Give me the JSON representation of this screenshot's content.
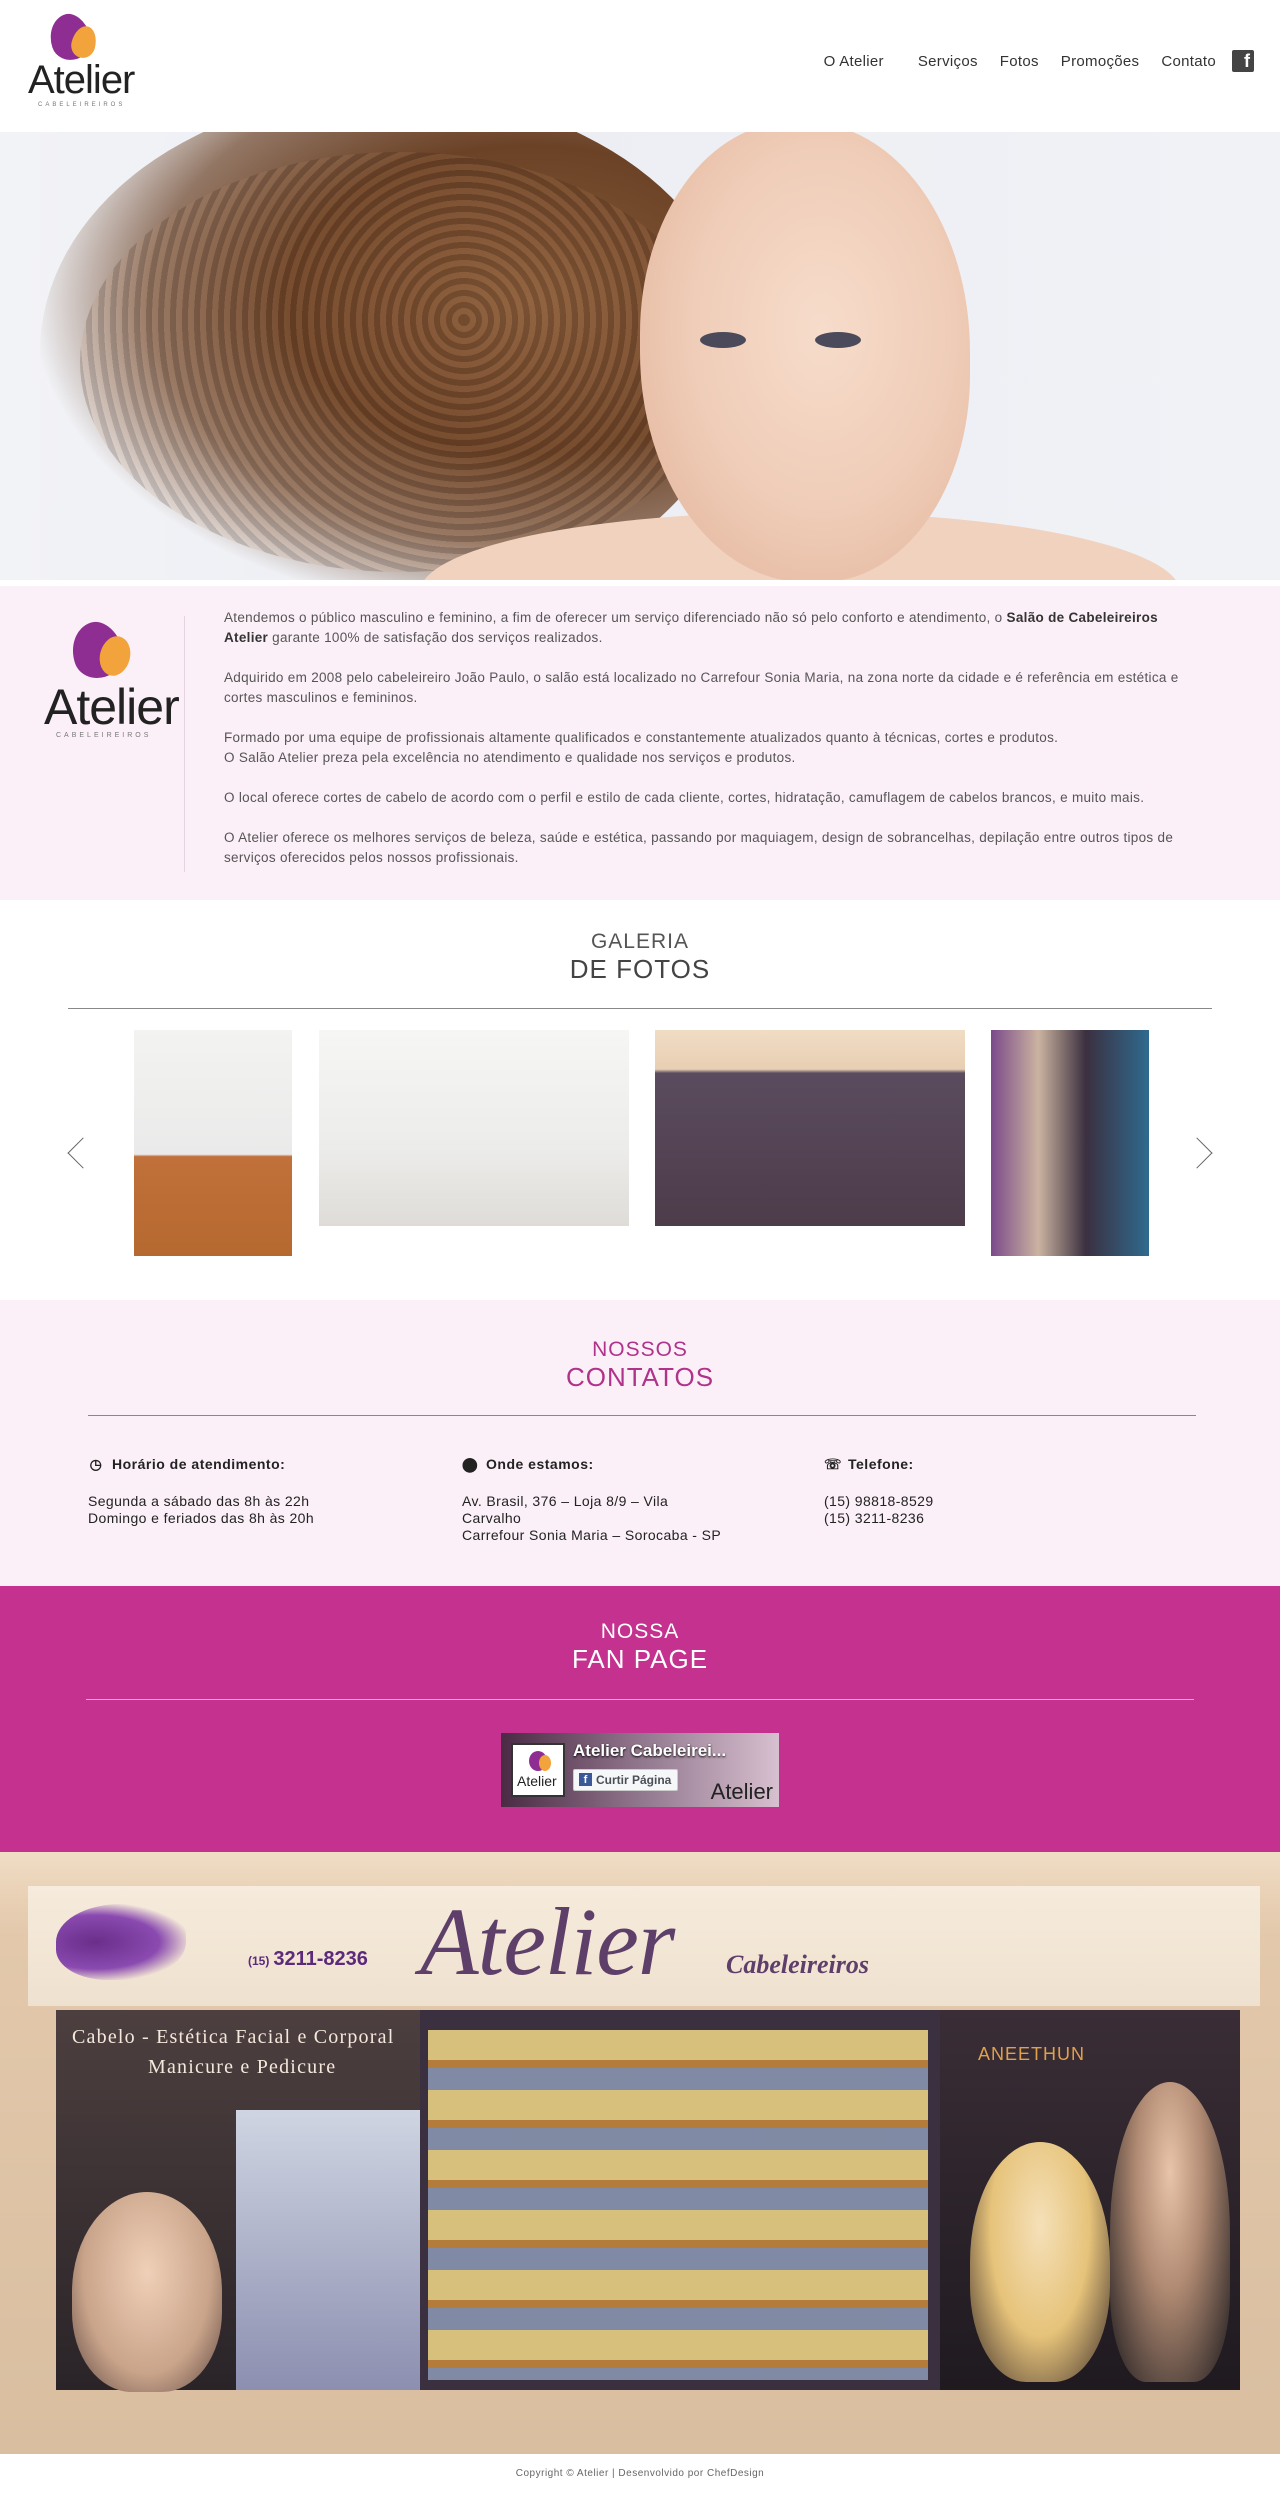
{
  "brand": {
    "logo_word": "Atelier",
    "logo_sub": "CABELEIREIROS",
    "purple": "#8e2e93",
    "orange": "#f2a33b",
    "pink": "#c4318f"
  },
  "nav": {
    "items": [
      {
        "label": "O Atelier"
      },
      {
        "label": "Serviços"
      },
      {
        "label": "Fotos"
      },
      {
        "label": "Promoções"
      },
      {
        "label": "Contato"
      }
    ],
    "facebook_icon": "facebook-icon"
  },
  "about": {
    "p1_a": "Atendemos o público masculino e feminino, a fim de oferecer um serviço diferenciado não só pelo conforto e atendimento, o ",
    "p1_bold": "Salão de Cabeleireiros Atelier",
    "p1_b": " garante 100% de satisfação dos serviços realizados.",
    "p2": "Adquirido em 2008 pelo cabeleireiro João Paulo, o salão está localizado no Carrefour Sonia Maria, na zona norte da cidade e é referência em estética e cortes masculinos e femininos.",
    "p3_a": "Formado por uma equipe de profissionais altamente qualificados e constantemente atualizados quanto à técnicas, cortes e produtos.",
    "p3_b": "O Salão Atelier preza pela excelência no atendimento e qualidade nos serviços e produtos.",
    "p4": "O local oferece cortes de cabelo de acordo com o perfil e estilo de cada cliente, cortes, hidratação, camuflagem de cabelos brancos, e muito mais.",
    "p5": "O Atelier oferece os melhores serviços de beleza, saúde e estética, passando por maquiagem, design de sobrancelhas, depilação entre outros tipos de serviços oferecidos pelos nossos profissionais."
  },
  "gallery": {
    "title_top": "GALERIA",
    "title_bottom": "DE FOTOS"
  },
  "contacts": {
    "title_top": "NOSSOS",
    "title_bottom": "CONTATOS",
    "hours": {
      "heading": "Horário de atendimento:",
      "line1": "Segunda a sábado das 8h às 22h",
      "line2": "Domingo e feriados das 8h às 20h"
    },
    "address": {
      "heading": "Onde estamos:",
      "line1": "Av. Brasil, 376 – Loja 8/9 – Vila",
      "line2": "Carvalho",
      "line3": "Carrefour Sonia Maria – Sorocaba - SP"
    },
    "phone": {
      "heading": "Telefone:",
      "line1": "(15) 98818-8529",
      "line2": "(15) 3211-8236"
    }
  },
  "fanpage": {
    "title_top": "NOSSA",
    "title_bottom": "FAN PAGE",
    "page_name": "Atelier Cabeleirei...",
    "like_label": "Curtir Página",
    "thumb_word": "Atelier",
    "corner_word": "Atelier"
  },
  "storefront": {
    "phone_prefix": "(15)",
    "phone": "3211-8236",
    "brand": "Atelier",
    "brand2": "Cabeleireiros",
    "line1": "Cabelo - Estética Facial e Corporal",
    "line2": "Manicure e Pedicure",
    "anee": "ANEETHUN"
  },
  "footer": {
    "text": "Copyright © Atelier | Desenvolvido por ChefDesign"
  }
}
